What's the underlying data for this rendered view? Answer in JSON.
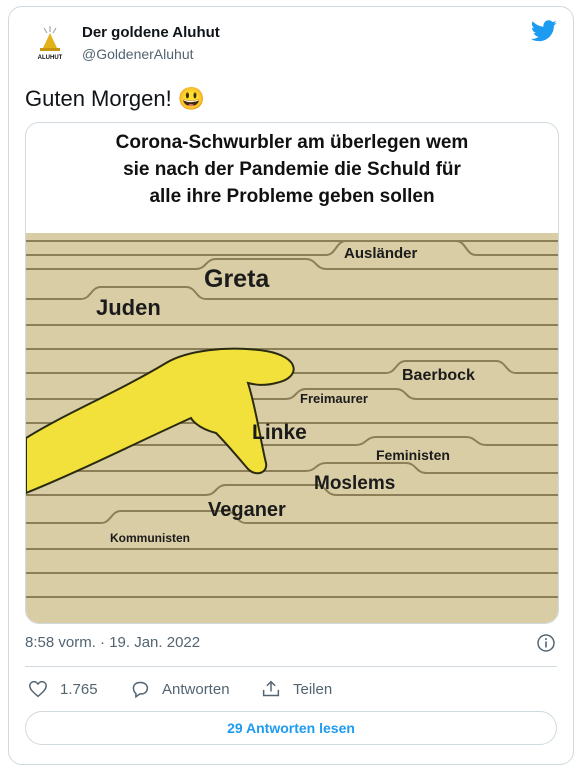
{
  "header": {
    "display_name": "Der goldene Aluhut",
    "handle": "@GoldenerAluhut",
    "avatar_text": "ALUHUT"
  },
  "tweet": {
    "text": "Guten Morgen! 😃",
    "timestamp": "8:58 vorm. · 19. Jan. 2022"
  },
  "meme": {
    "title_lines": [
      "Corona-Schwurbler am überlegen wem",
      "sie nach der Pandemie die Schuld für",
      "alle ihre Probleme geben sollen"
    ],
    "labels": {
      "auslaender": "Ausländer",
      "greta": "Greta",
      "juden": "Juden",
      "baerbock": "Baerbock",
      "freimaurer": "Freimaurer",
      "linke": "Linke",
      "feministen": "Feministen",
      "moslems": "Moslems",
      "veganer": "Veganer",
      "kommunisten": "Kommunisten"
    }
  },
  "actions": {
    "likes": "1.765",
    "reply_label": "Antworten",
    "share_label": "Teilen",
    "read_replies": "29 Antworten lesen"
  },
  "colors": {
    "twitter_blue": "#1d9bf0",
    "muted": "#536471",
    "border": "#cfd9de",
    "folder": "#d8cca3",
    "hand": "#f2e13b"
  }
}
